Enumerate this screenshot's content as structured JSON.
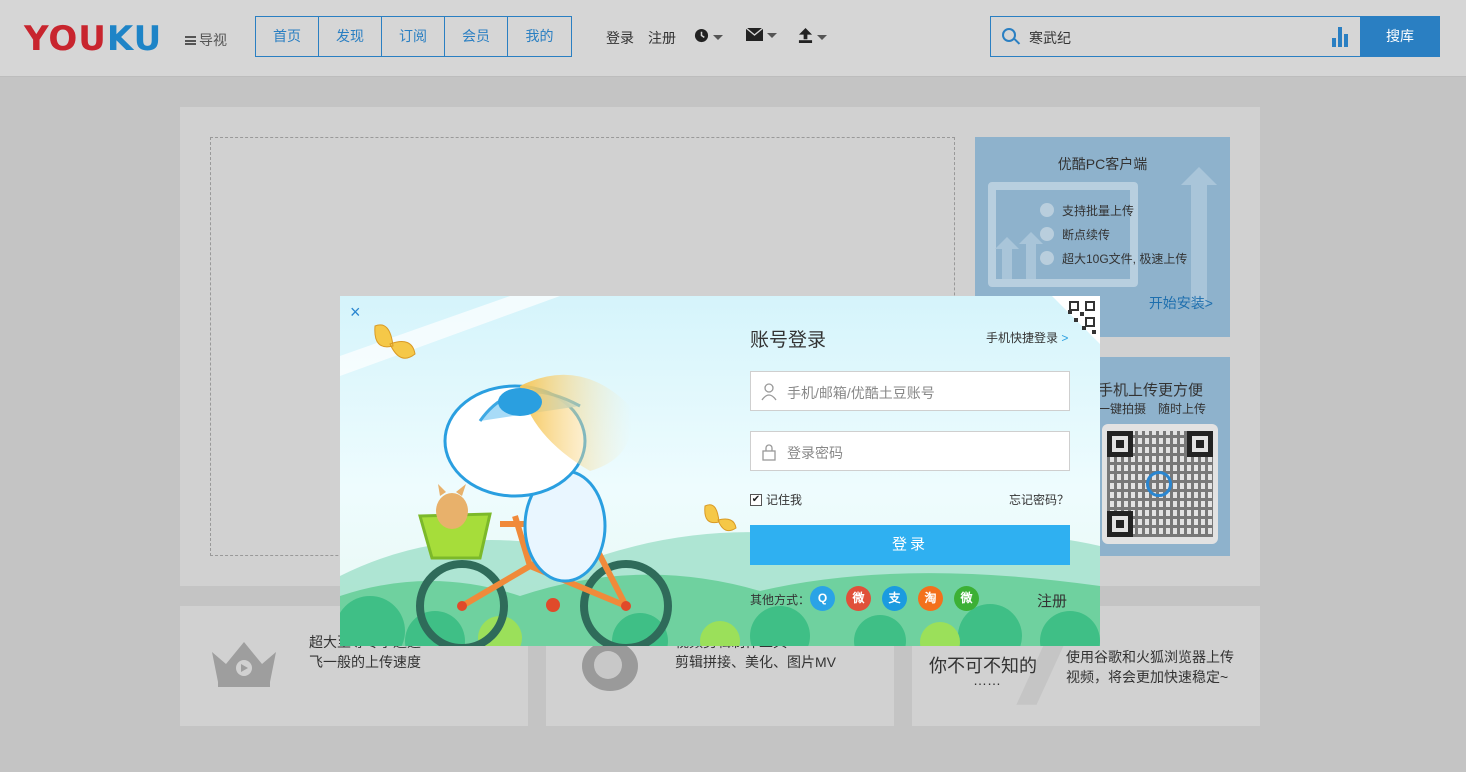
{
  "header": {
    "logo": {
      "part1": "YOU",
      "part2": "KU"
    },
    "guide_label": "导视",
    "nav": [
      "首页",
      "发现",
      "订阅",
      "会员",
      "我的"
    ],
    "login_link": "登录",
    "register_link": "注册",
    "search_value": "寒武纪",
    "search_button": "搜库",
    "icons": [
      "history-icon",
      "mail-icon",
      "upload-icon"
    ]
  },
  "pc_client": {
    "title": "优酷PC客户端",
    "features": [
      "支持批量上传",
      "断点续传",
      "超大10G文件, 极速上传"
    ],
    "install_link": "开始安装>"
  },
  "mobile_card": {
    "title": "手机上传更方便",
    "subtitle": "一键拍摄　随时上传"
  },
  "features": [
    {
      "line1": "超大至尊专享通道",
      "line2": "飞一般的上传速度"
    },
    {
      "line1": "视频剪辑制作工具",
      "line2": "剪辑拼接、美化、图片MV"
    },
    {
      "title": "你不可不知的",
      "dots": "……",
      "line1": "使用谷歌和火狐浏览器上传",
      "line2": "视频，将会更加快速稳定~"
    }
  ],
  "login_modal": {
    "close": "×",
    "title": "账号登录",
    "quick_login": "手机快捷登录",
    "quick_arrow": ">",
    "account_placeholder": "手机/邮箱/优酷土豆账号",
    "password_placeholder": "登录密码",
    "remember_me": "记住我",
    "remember_checked": true,
    "forgot": "忘记密码？",
    "login_button": "登录",
    "other_ways": "其他方式：",
    "social": [
      {
        "name": "qq-icon",
        "color": "#2aa3e6",
        "glyph": "Q"
      },
      {
        "name": "weibo-icon",
        "color": "#e0503a",
        "glyph": "微"
      },
      {
        "name": "alipay-icon",
        "color": "#1b9be0",
        "glyph": "支"
      },
      {
        "name": "taobao-icon",
        "color": "#f3701c",
        "glyph": "淘"
      },
      {
        "name": "wechat-icon",
        "color": "#3cb035",
        "glyph": "微"
      }
    ],
    "register": "注册"
  }
}
